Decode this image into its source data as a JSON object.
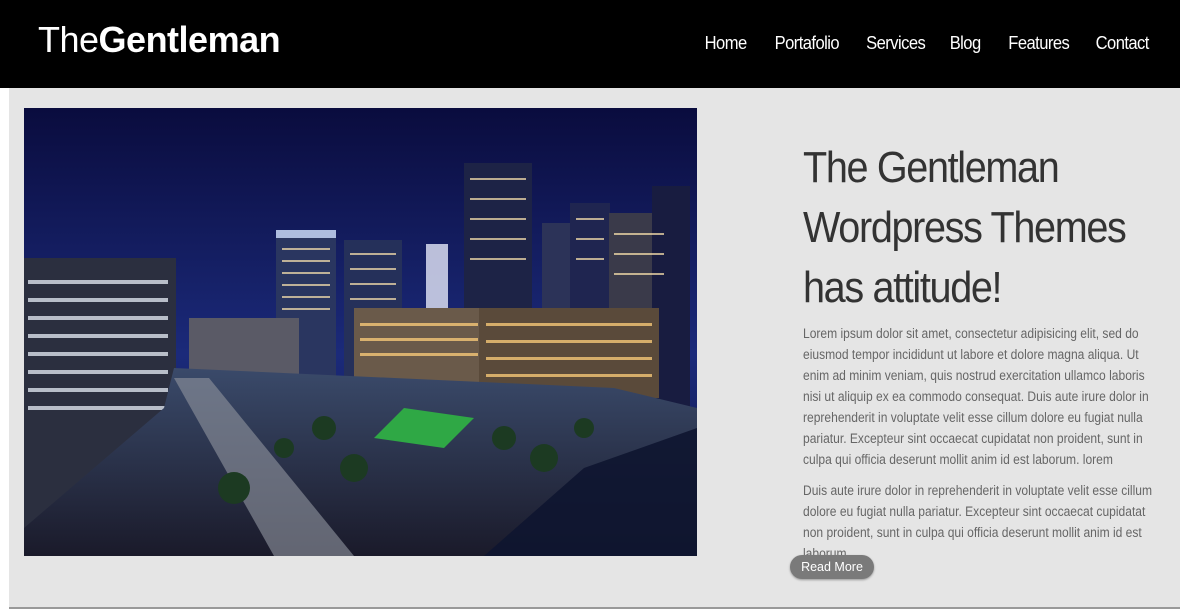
{
  "header": {
    "logo_light": "The",
    "logo_bold": "Gentleman",
    "nav": [
      "Home",
      "Portafolio",
      "Services",
      "Blog",
      "Features",
      "Contact"
    ]
  },
  "hero": {
    "image_description_icon": "city-night-photo",
    "headline_lines": [
      "The Gentleman",
      "Wordpress Themes",
      "has attitude!"
    ],
    "paragraph_1": "Lorem ipsum dolor sit amet, consectetur adipisicing elit, sed do eiusmod tempor incididunt ut labore et dolore magna aliqua. Ut enim ad minim veniam, quis nostrud exercitation ullamco laboris nisi ut aliquip ex ea commodo consequat. Duis aute irure dolor in reprehenderit in voluptate velit esse cillum dolore eu fugiat nulla pariatur. Excepteur sint occaecat cupidatat non proident, sunt in culpa qui officia deserunt mollit anim id est laborum. lorem",
    "paragraph_2": "Duis aute irure dolor in reprehenderit in voluptate velit esse cillum dolore eu fugiat nulla pariatur. Excepteur sint occaecat cupidatat non proident, sunt in culpa qui officia deserunt mollit anim id est laborum.",
    "read_more_label": "Read More"
  },
  "colors": {
    "header_bg": "#000000",
    "content_bg": "#e5e5e5",
    "headline": "#333333",
    "body_text": "#666666",
    "button_bg": "#7a7a7a"
  }
}
